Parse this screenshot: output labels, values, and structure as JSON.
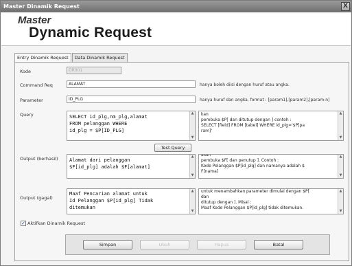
{
  "window": {
    "title": "Master Dinamik Request",
    "close_glyph": "X"
  },
  "banner": {
    "line1": "Master",
    "line2": "Dynamic Request"
  },
  "tabs": [
    {
      "label": "Entry Dinamik Request",
      "active": true
    },
    {
      "label": "Data Dinamik Request",
      "active": false
    }
  ],
  "form": {
    "kode": {
      "label": "Kode",
      "value": "DR001",
      "disabled": true
    },
    "command": {
      "label": "Command Req",
      "value": "ALAMAT",
      "hint": "hanya boleh diisi dengan huruf atau angka."
    },
    "parameter": {
      "label": "Parameter",
      "value": "ID_PLG",
      "hint": "hanya huruf dan angka. format : [param1],[param2],[param-n]"
    },
    "query": {
      "label": "Query",
      "value": "SELECT id_plg,nm_plg,alamat\nFROM pelanggan WHERE\nid_plg = $P[ID_PLG]",
      "help": "kan\npembuka $P[ dan ditutup dengan ] contoh :\nSELECT [field] FROM [tabel] WHERE id_plg='$P[pa\nram]'"
    },
    "test_query_button": "Test Query",
    "output_success": {
      "label": "Output (berhasil)",
      "value": "Alamat dari pelanggan\n$F[id_plg] adalah $F[alamat]",
      "help": "akan\npembuka $F[ dan penutup ]. Contoh :\nKode Pelanggan $P[id_plg] dan namanya adalah $\nF[nama]"
    },
    "output_fail": {
      "label": "Output (gagal)",
      "value": "Maaf Pencarian alamat untuk\nId Pelanggan $P[id_plg] Tidak\nditemukan",
      "help": "untuk menambahkan parameter dimulai dengan $P[\ndan\nditutup dengan ]. Misal :\nMaaf Kode Pelanggan $P[id_plg] tidak ditemukan."
    },
    "enable_checkbox": {
      "label": "Aktifkan Dinamik Request",
      "checked": true
    }
  },
  "buttons": {
    "save": "Simpan",
    "edit": "Ubah",
    "delete": "Hapus",
    "cancel": "Batal"
  },
  "icons": {
    "scroll_up": "▲",
    "scroll_down": "▼",
    "check": "✓"
  }
}
